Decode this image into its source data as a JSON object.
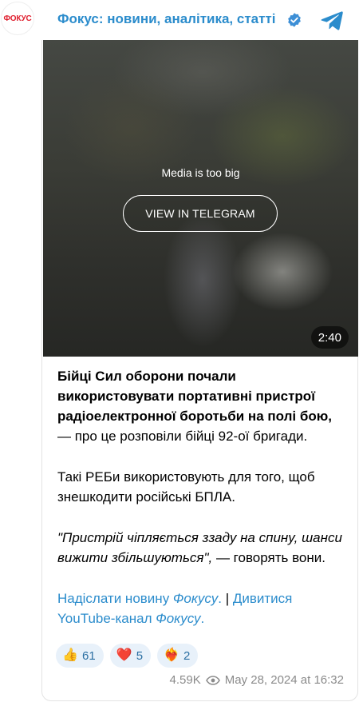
{
  "header": {
    "avatar_text": "ФОКУС",
    "title": "Фокус: новини, аналітика, статті"
  },
  "media": {
    "message": "Media is too big",
    "button_label": "VIEW IN TELEGRAM",
    "duration": "2:40"
  },
  "post": {
    "p1_bold": "Бійці Сил оборони почали використовувати портативні пристрої радіоелектронної боротьби на полі бою,",
    "p1_rest": " — про це розповіли бійці 92-ої бригади.",
    "p2": "Такі РЕБи використовують для того, щоб знешкодити російські БПЛА.",
    "p3_quote": "\"Пристрій чіпляється ззаду на спину, шанси вижити збільшуються\",",
    "p3_rest": " — говорять вони.",
    "link1_a": "Надіслати новину ",
    "link1_b": "Фокусу",
    "link1_c": ".",
    "separator": " | ",
    "link2_a": "Дивитися YouTube-канал ",
    "link2_b": "Фокусу",
    "link2_c": "."
  },
  "reactions": [
    {
      "emoji": "👍",
      "icon": "thumbs-up-icon",
      "count": "61"
    },
    {
      "emoji": "❤️",
      "icon": "red-heart-icon",
      "count": "5"
    },
    {
      "emoji": "❤️‍🔥",
      "icon": "heart-on-fire-icon",
      "count": "2"
    }
  ],
  "footer": {
    "views": "4.59K",
    "date": "May 28, 2024 at 16:32"
  },
  "colors": {
    "link": "#2b8ccc",
    "reaction_bg": "#e8f1fa",
    "meta": "#8a8a8a"
  }
}
